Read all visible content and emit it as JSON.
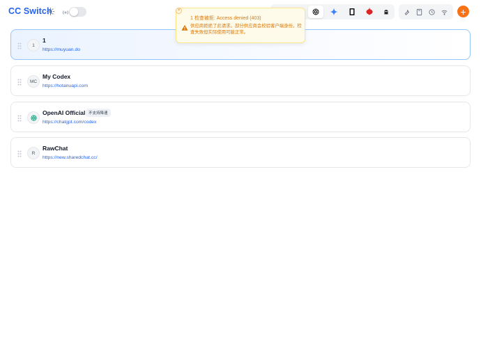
{
  "app": {
    "title": "CC Switch"
  },
  "colors": {
    "accent": "#2563eb",
    "add_button": "#f97316",
    "warning": "#d97706"
  },
  "header": {
    "app_switcher": [
      {
        "icon": "unknown-app-icon",
        "active": false
      },
      {
        "icon": "openai-icon",
        "active": true
      },
      {
        "icon": "gemini-icon",
        "active": false
      },
      {
        "icon": "terminal-app-icon",
        "active": false
      },
      {
        "icon": "red-app-icon",
        "active": false
      },
      {
        "icon": "mascot-app-icon",
        "active": false
      }
    ],
    "tools": [
      "wrench-icon",
      "book-icon",
      "history-icon",
      "signal-icon"
    ],
    "add_label": "+"
  },
  "providers": [
    {
      "avatar": "1",
      "name": "1",
      "url": "https://muyuan.do",
      "badge": "",
      "current": true
    },
    {
      "avatar": "MC",
      "name": "My Codex",
      "url": "https://hotanuapi.com",
      "badge": "",
      "current": false
    },
    {
      "avatar": "",
      "name": "OpenAI Official",
      "url": "https://chatgpt.com/codex",
      "badge": "不支持降速",
      "current": false
    },
    {
      "avatar": "R",
      "name": "RawChat",
      "url": "https://new.sharedchat.cc/",
      "badge": "",
      "current": false
    }
  ],
  "toast": {
    "close_label": "×",
    "title": "1 检查被拒: Access denied (403)",
    "description": "供应商拒绝了此请求。部分供应商会校验客户端身份。检查失败但实际使用可能正常。"
  }
}
